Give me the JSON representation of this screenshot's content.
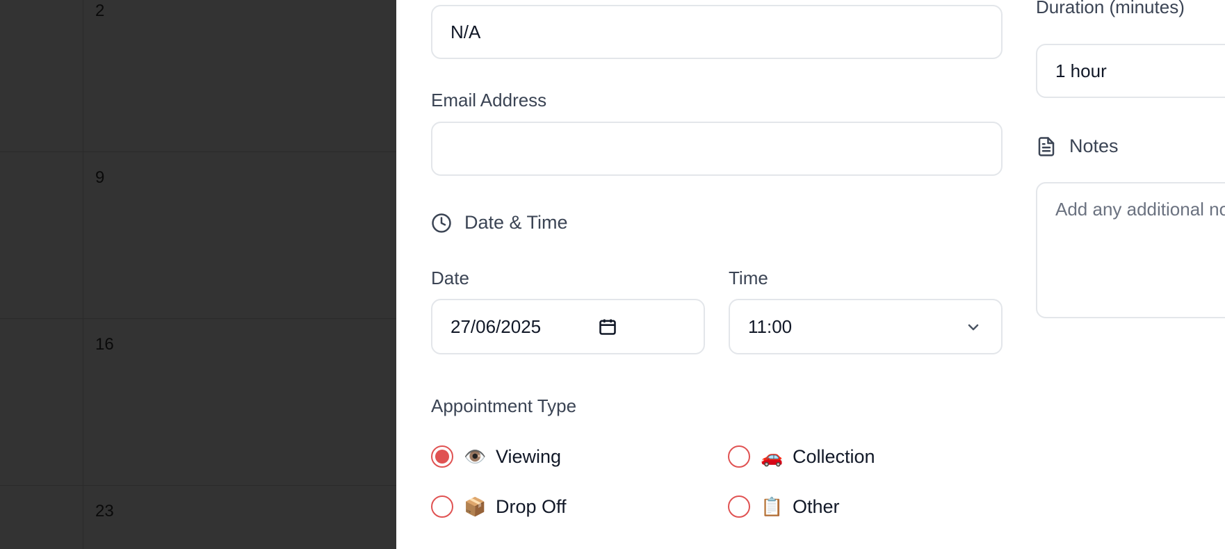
{
  "calendar": {
    "days": [
      "2",
      "9",
      "16",
      "23"
    ]
  },
  "contact": {
    "phone_value": "N/A",
    "email_label": "Email Address",
    "email_value": ""
  },
  "datetime": {
    "section_title": "Date & Time",
    "date_label": "Date",
    "date_value": "27/06/2025",
    "time_label": "Time",
    "time_value": "11:00"
  },
  "appointment_type": {
    "label": "Appointment Type",
    "options": [
      {
        "emoji": "👁️",
        "label": "Viewing",
        "selected": true
      },
      {
        "emoji": "🚗",
        "label": "Collection",
        "selected": false
      },
      {
        "emoji": "📦",
        "label": "Drop Off",
        "selected": false
      },
      {
        "emoji": "📋",
        "label": "Other",
        "selected": false
      }
    ]
  },
  "duration": {
    "label": "Duration (minutes)",
    "value": "1 hour"
  },
  "notes": {
    "section_title": "Notes",
    "placeholder": "Add any additional notes..."
  },
  "colors": {
    "accent": "#e05252",
    "overlay": "#333333",
    "border": "#e3e6ea",
    "label_text": "#3b4454"
  },
  "icons": {
    "datetime_icon": "clock-icon",
    "notes_icon": "document-icon",
    "calendar_picker_icon": "calendar-icon",
    "time_dropdown_icon": "chevron-down-icon"
  }
}
